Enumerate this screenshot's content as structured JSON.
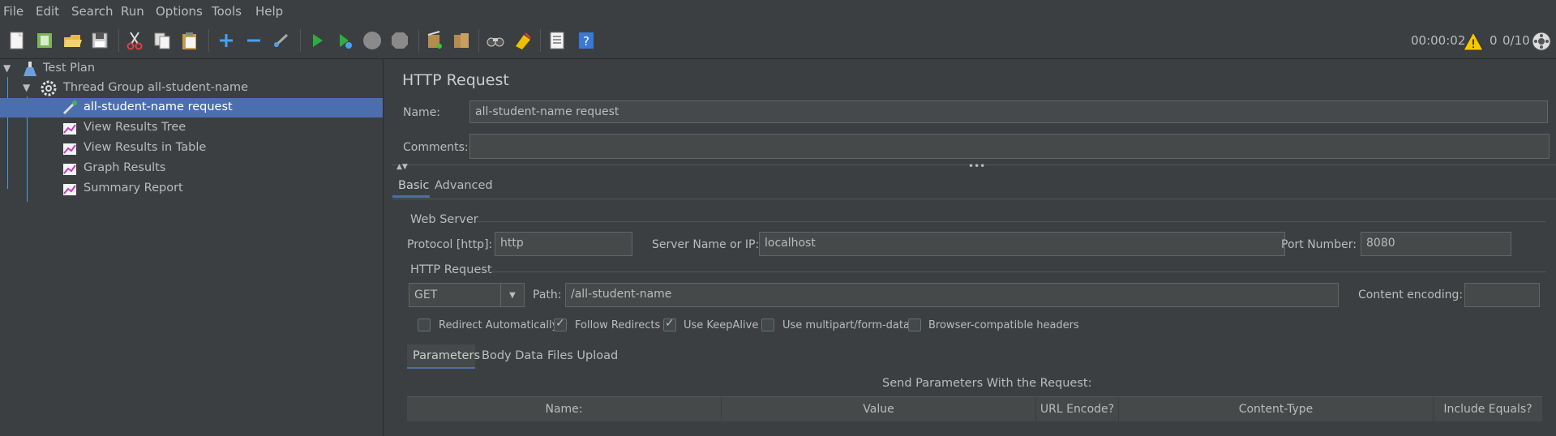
{
  "menu": [
    {
      "label": "File"
    },
    {
      "label": "Edit"
    },
    {
      "label": "Search"
    },
    {
      "label": "Run"
    },
    {
      "label": "Options"
    },
    {
      "label": "Tools"
    },
    {
      "label": "Help"
    }
  ],
  "toolbar": {
    "icons": [
      "new-icon",
      "templates-icon",
      "open-icon",
      "save-icon",
      "cut-icon",
      "copy-icon",
      "paste-icon",
      "expand-icon",
      "collapse-icon",
      "toggle-icon",
      "start-icon",
      "start-no-pauses-icon",
      "stop-icon",
      "shutdown-icon",
      "clear-icon",
      "clear-all-icon",
      "search-icon",
      "reset-search-icon",
      "function-helper-icon",
      "help-icon"
    ],
    "elapsed": "00:00:02",
    "warnings": "0",
    "threads": "0/10"
  },
  "tree": {
    "items": [
      {
        "label": "Test Plan"
      },
      {
        "label": "Thread Group all-student-name"
      },
      {
        "label": "all-student-name request"
      },
      {
        "label": "View Results Tree"
      },
      {
        "label": "View Results in Table"
      },
      {
        "label": "Graph Results"
      },
      {
        "label": "Summary Report"
      }
    ]
  },
  "panel": {
    "title": "HTTP Request",
    "name_label": "Name:",
    "name_value": "all-student-name request",
    "comments_label": "Comments:",
    "comments_value": "",
    "tabs": [
      {
        "label": "Basic"
      },
      {
        "label": "Advanced"
      }
    ],
    "web_server": {
      "section": "Web Server",
      "protocol_label": "Protocol [http]:",
      "protocol_value": "http",
      "server_label": "Server Name or IP:",
      "server_value": "localhost",
      "port_label": "Port Number:",
      "port_value": "8080"
    },
    "http_request": {
      "section": "HTTP Request",
      "method": "GET",
      "path_label": "Path:",
      "path_value": "/all-student-name",
      "encoding_label": "Content encoding:",
      "encoding_value": ""
    },
    "checkboxes": [
      {
        "label": "Redirect Automatically",
        "checked": false
      },
      {
        "label": "Follow Redirects",
        "checked": true
      },
      {
        "label": "Use KeepAlive",
        "checked": true
      },
      {
        "label": "Use multipart/form-data",
        "checked": false
      },
      {
        "label": "Browser-compatible headers",
        "checked": false
      }
    ],
    "param_tabs": [
      {
        "label": "Parameters"
      },
      {
        "label": "Body Data"
      },
      {
        "label": "Files Upload"
      }
    ],
    "params_caption": "Send Parameters With the Request:",
    "columns": [
      "Name:",
      "Value",
      "URL Encode?",
      "Content-Type",
      "Include Equals?"
    ]
  },
  "colors": {
    "background": "#3c3f41",
    "selection": "#4b6eaf",
    "field": "#45494a",
    "text": "#bbbbbb"
  }
}
